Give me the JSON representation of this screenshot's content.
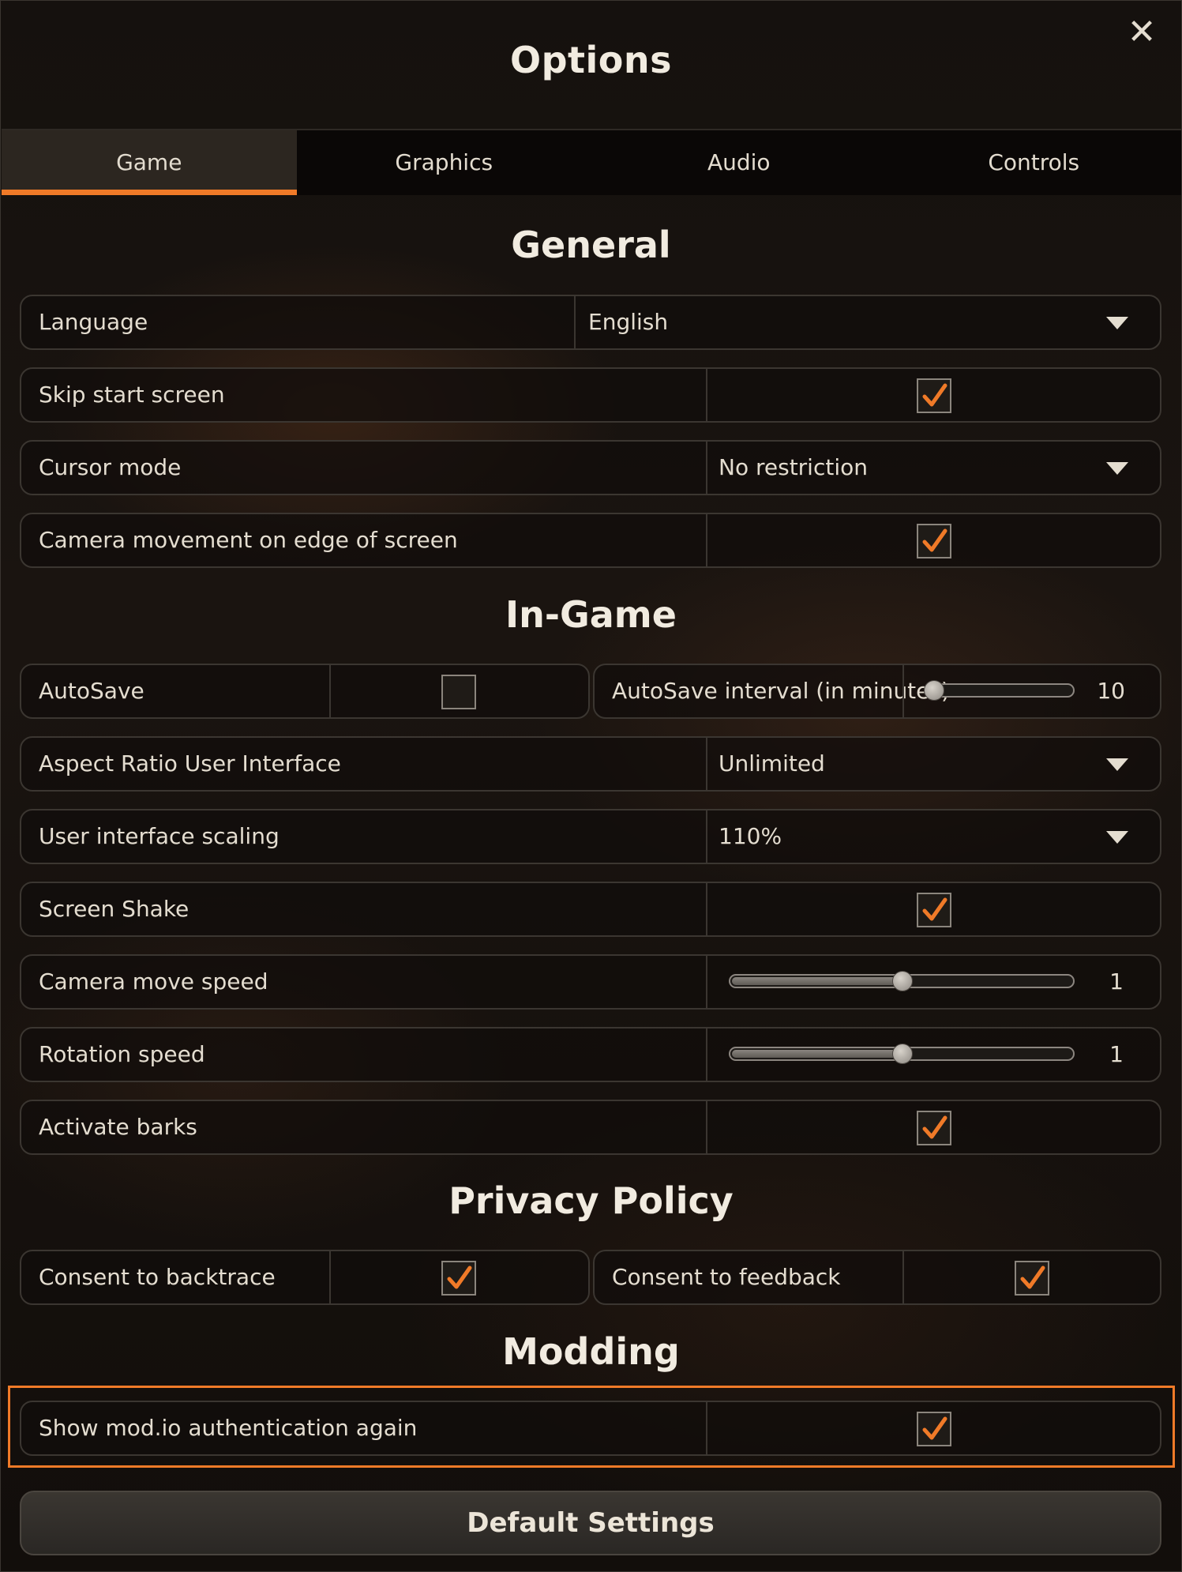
{
  "window": {
    "title": "Options",
    "close_icon": "close-icon"
  },
  "tabs": [
    {
      "label": "Game",
      "active": true
    },
    {
      "label": "Graphics",
      "active": false
    },
    {
      "label": "Audio",
      "active": false
    },
    {
      "label": "Controls",
      "active": false
    }
  ],
  "sections": {
    "general": "General",
    "ingame": "In-Game",
    "privacy": "Privacy Policy",
    "modding": "Modding"
  },
  "general": {
    "language": {
      "label": "Language",
      "value": "English"
    },
    "skip_start": {
      "label": "Skip start screen",
      "checked": true
    },
    "cursor_mode": {
      "label": "Cursor mode",
      "value": "No restriction"
    },
    "camera_edge": {
      "label": "Camera movement on edge of screen",
      "checked": true
    }
  },
  "ingame": {
    "autosave": {
      "label": "AutoSave",
      "checked": false
    },
    "autosave_interval": {
      "label": "AutoSave interval (in minutes)",
      "value": "10",
      "level": 0.05
    },
    "aspect_ratio": {
      "label": "Aspect Ratio User Interface",
      "value": "Unlimited"
    },
    "ui_scaling": {
      "label": "User interface scaling",
      "value": "110%"
    },
    "screen_shake": {
      "label": "Screen Shake",
      "checked": true
    },
    "camera_speed": {
      "label": "Camera move speed",
      "value": "1",
      "level": 0.5
    },
    "rotation_speed": {
      "label": "Rotation speed",
      "value": "1",
      "level": 0.5
    },
    "barks": {
      "label": "Activate barks",
      "checked": true
    }
  },
  "privacy": {
    "backtrace": {
      "label": "Consent to backtrace",
      "checked": true
    },
    "feedback": {
      "label": "Consent to feedback",
      "checked": true
    }
  },
  "modding": {
    "modio": {
      "label": "Show mod.io authentication again",
      "checked": true
    }
  },
  "footer": {
    "default_button": "Default Settings"
  },
  "colors": {
    "accent": "#f07a28",
    "text": "#e4ddd0",
    "border": "#3b3631"
  }
}
